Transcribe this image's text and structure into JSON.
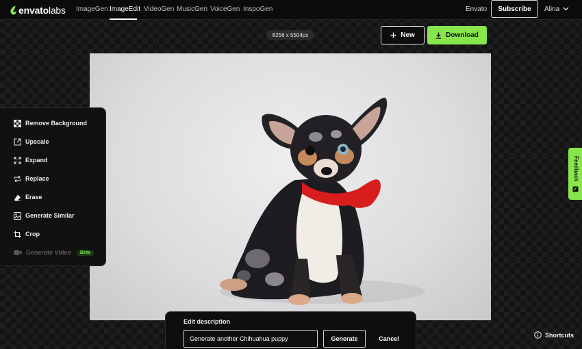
{
  "brand": {
    "name": "envato",
    "suffix": "labs",
    "accent": "#87e64b"
  },
  "nav": {
    "items": [
      "ImageGen",
      "ImageEdit",
      "VideoGen",
      "MusicGen",
      "VoiceGen",
      "InspoGen"
    ],
    "active": "ImageEdit"
  },
  "header": {
    "envato_link": "Envato",
    "subscribe_label": "Subscribe",
    "user_name": "Alina"
  },
  "toolbar": {
    "dimensions": "8256 x 5504px",
    "new_label": "New",
    "download_label": "Download"
  },
  "tools": [
    {
      "label": "Remove Background",
      "icon": "remove-background-icon"
    },
    {
      "label": "Upscale",
      "icon": "upscale-icon"
    },
    {
      "label": "Expand",
      "icon": "expand-icon"
    },
    {
      "label": "Replace",
      "icon": "replace-icon"
    },
    {
      "label": "Erase",
      "icon": "eraser-icon"
    },
    {
      "label": "Generate Similar",
      "icon": "image-icon"
    },
    {
      "label": "Crop",
      "icon": "crop-icon"
    },
    {
      "label": "Generate Video",
      "icon": "video-icon",
      "badge": "Beta",
      "disabled": true
    }
  ],
  "feedback": {
    "label": "Feedback"
  },
  "edit": {
    "title": "Edit description",
    "input_value": "Generate another Chihuahua puppy",
    "generate_label": "Generate",
    "cancel_label": "Cancel"
  },
  "shortcuts_label": "Shortcuts"
}
